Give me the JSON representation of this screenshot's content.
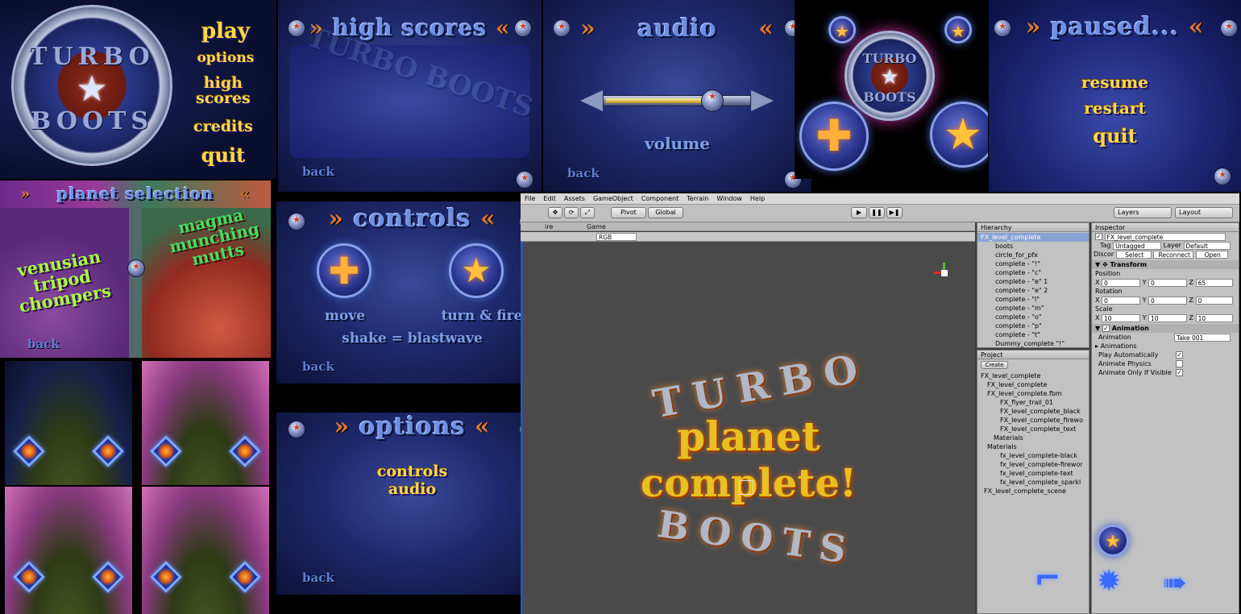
{
  "main_menu": {
    "logo_top": "TURBO",
    "logo_bottom": "BOOTS",
    "items": [
      "play",
      "options",
      "high scores",
      "credits",
      "quit"
    ]
  },
  "high_scores": {
    "chev_left": "»",
    "title": "high scores",
    "chev_right": "«",
    "back": "back",
    "watermark": "TURBO BOOTS"
  },
  "audio": {
    "chev_left": "»",
    "title": "audio",
    "chev_right": "«",
    "slider_label": "volume",
    "volume_level": 0.65,
    "back": "back"
  },
  "pause_buttons": {
    "emblem_top": "TURBO",
    "emblem_bottom": "BOOTS"
  },
  "paused": {
    "chev_left": "»",
    "title": "paused...",
    "chev_right": "«",
    "items": [
      "resume",
      "restart",
      "quit"
    ]
  },
  "planet_selection": {
    "chev_left": "»",
    "title": "planet selection",
    "chev_right": "«",
    "planet_left": "venusian tripod chompers",
    "planet_right": "magma munching mutts",
    "back": "back"
  },
  "controls": {
    "chev_left": "»",
    "title": "controls",
    "chev_right": "«",
    "move_label": "move",
    "turn_label": "turn & fire",
    "shake_label": "shake = blastwave",
    "back": "back"
  },
  "options": {
    "chev_left": "»",
    "title": "options",
    "chev_right": "«",
    "items": [
      "controls",
      "audio"
    ],
    "back": "back"
  },
  "unity": {
    "menu": [
      "File",
      "Edit",
      "Assets",
      "GameObject",
      "Component",
      "Terrain",
      "Window",
      "Help"
    ],
    "pivot": "Pivot",
    "global": "Global",
    "layers": "Layers",
    "layout": "Layout",
    "tab_game": "Game",
    "rgb": "RGB",
    "tab_scene_partial": "ire",
    "scene_text": {
      "ring_top": "TURBO",
      "line1": "planet",
      "line2": "complete!",
      "ring_bottom": "BOOTS"
    },
    "hierarchy": {
      "title": "Hierarchy",
      "items": [
        "FX_level_complete",
        "boots",
        "circle_for_pfx",
        "complete - \"!\"",
        "complete - \"c\"",
        "complete - \"e\" 1",
        "complete - \"e\" 2",
        "complete - \"l\"",
        "complete - \"m\"",
        "complete - \"o\"",
        "complete - \"p\"",
        "complete - \"t\"",
        "Dummy_complete \"!\""
      ]
    },
    "project": {
      "title": "Project",
      "create": "Create",
      "items": [
        "FX_level_complete",
        "FX_level_complete",
        "FX_level_complete.fbm",
        "FX_flyer_trail_01",
        "FX_level_complete_black",
        "FX_level_complete_firewo",
        "FX_level_complete_text",
        "Materials",
        "Materials",
        "fx_level_complete-black",
        "fx_level_complete-firewor",
        "fx_level_complete-text",
        "fx_level_complete_sparkl",
        "FX_level_complete_scene"
      ]
    },
    "inspector": {
      "title": "Inspector",
      "object": "FX_level_complete",
      "tag_label": "Tag",
      "tag": "Untagged",
      "layer_label": "Layer",
      "layer": "Default",
      "prefab_label": "Discor",
      "select": "Select",
      "reconnect": "Reconnect",
      "open": "Open",
      "transform": "Transform",
      "position": "Position",
      "pos": [
        "0",
        "0",
        "65"
      ],
      "rotation": "Rotation",
      "rot": [
        "0",
        "0",
        "0"
      ],
      "scale": "Scale",
      "scl": [
        "10",
        "10",
        "10"
      ],
      "animation": "Animation",
      "anim_field": "Animation",
      "anim_value": "Take 001",
      "animations": "Animations",
      "play_auto": "Play Automatically",
      "animate_physics": "Animate Physics",
      "animate_visible": "Animate Only If Visible",
      "play_auto_checked": true,
      "animate_physics_checked": false,
      "animate_visible_checked": true
    }
  }
}
